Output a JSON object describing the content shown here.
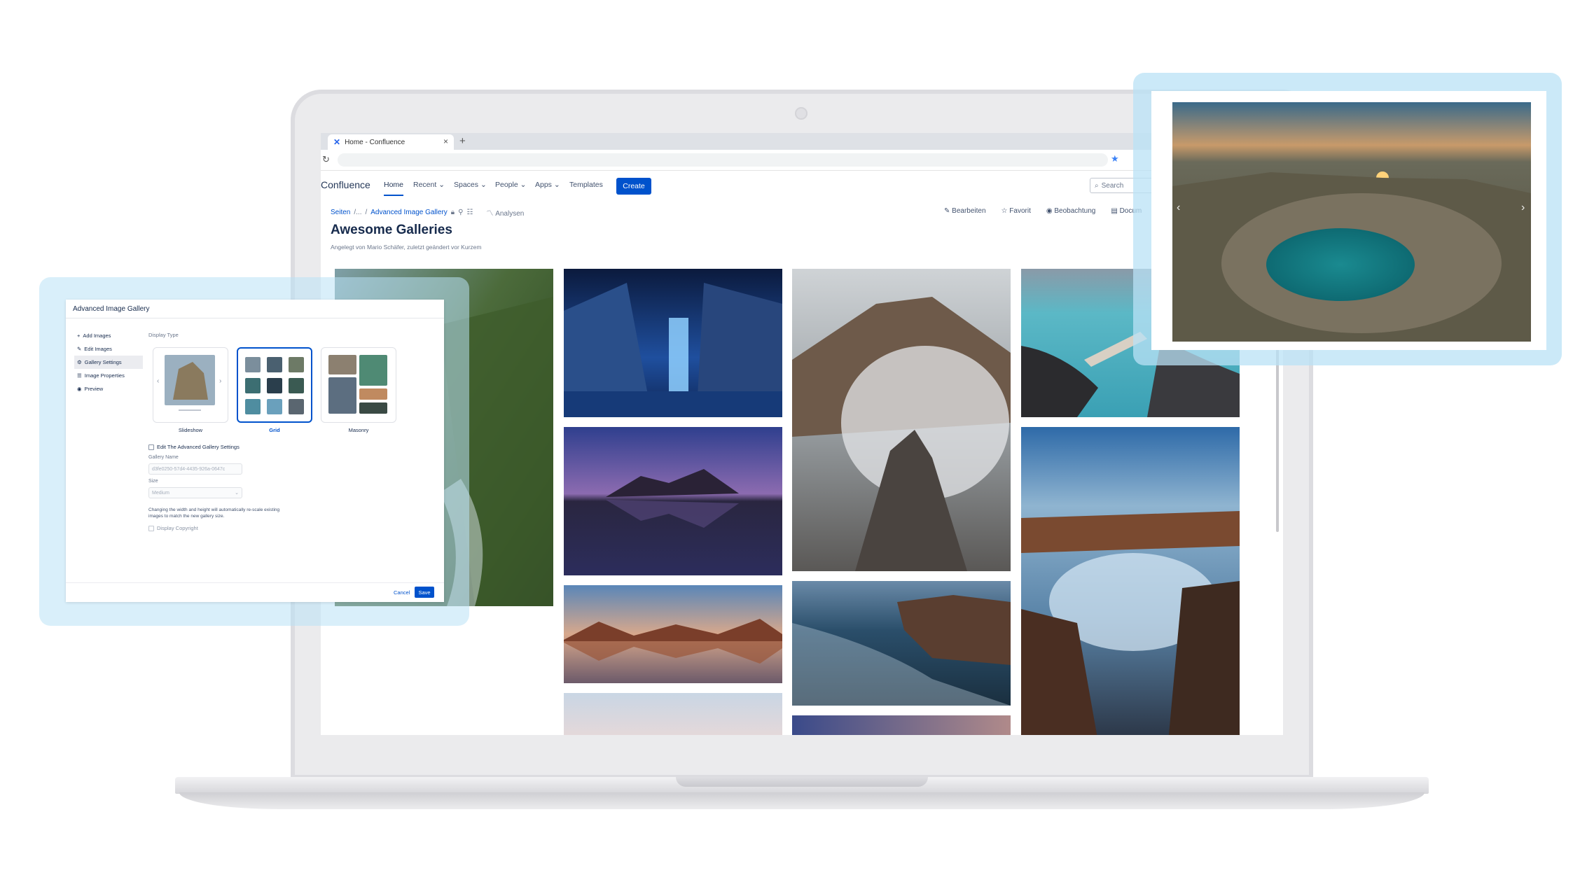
{
  "browser": {
    "tab_title": "Home - Confluence",
    "tab_close": "×",
    "new_tab": "+",
    "reload_icon": "↻",
    "bookmark_icon": "★"
  },
  "nav": {
    "brand": "Confluence",
    "home": "Home",
    "recent": "Recent",
    "spaces": "Spaces",
    "people": "People",
    "apps": "Apps",
    "templates": "Templates",
    "create": "Create",
    "search_placeholder": "Search"
  },
  "page": {
    "breadcrumb_root": "Seiten",
    "breadcrumb_ellipsis": "/...",
    "breadcrumb_sep": "/",
    "breadcrumb_current": "Advanced Image Gallery",
    "analytics": "Analysen",
    "actions": {
      "edit": "Bearbeiten",
      "favorite": "Favorit",
      "watch": "Beobachtung",
      "docs": "Docum"
    },
    "title": "Awesome Galleries",
    "byline": "Angelegt von Mario Schäfer, zuletzt geändert vor Kurzem"
  },
  "dialog": {
    "title": "Advanced Image Gallery",
    "menu": [
      {
        "icon": "+",
        "label": "Add Images"
      },
      {
        "icon": "✎",
        "label": "Edit Images"
      },
      {
        "icon": "⚙",
        "label": "Gallery Settings"
      },
      {
        "icon": "☰",
        "label": "Image Properties"
      },
      {
        "icon": "◉",
        "label": "Preview"
      }
    ],
    "display_type_label": "Display Type",
    "display_types": [
      "Slideshow",
      "Grid",
      "Masonry"
    ],
    "selected_display_type": "Grid",
    "edit_settings_label": "Edit The Advanced Gallery Settings",
    "gallery_name_label": "Gallery Name",
    "gallery_name_value": "d3fe0250-57d4-4435-926a-0647c",
    "size_label": "Size",
    "size_value": "Medium",
    "size_note": "Changing the width and height will automatically re-scale existing images to match the new gallery size.",
    "copyright_label": "Display Copyright",
    "cancel": "Cancel",
    "save": "Save"
  },
  "slideshow_preview": {
    "prev_icon": "‹",
    "next_icon": "›"
  },
  "colors": {
    "accent": "#0052cc",
    "halo": "#bae2f6"
  }
}
